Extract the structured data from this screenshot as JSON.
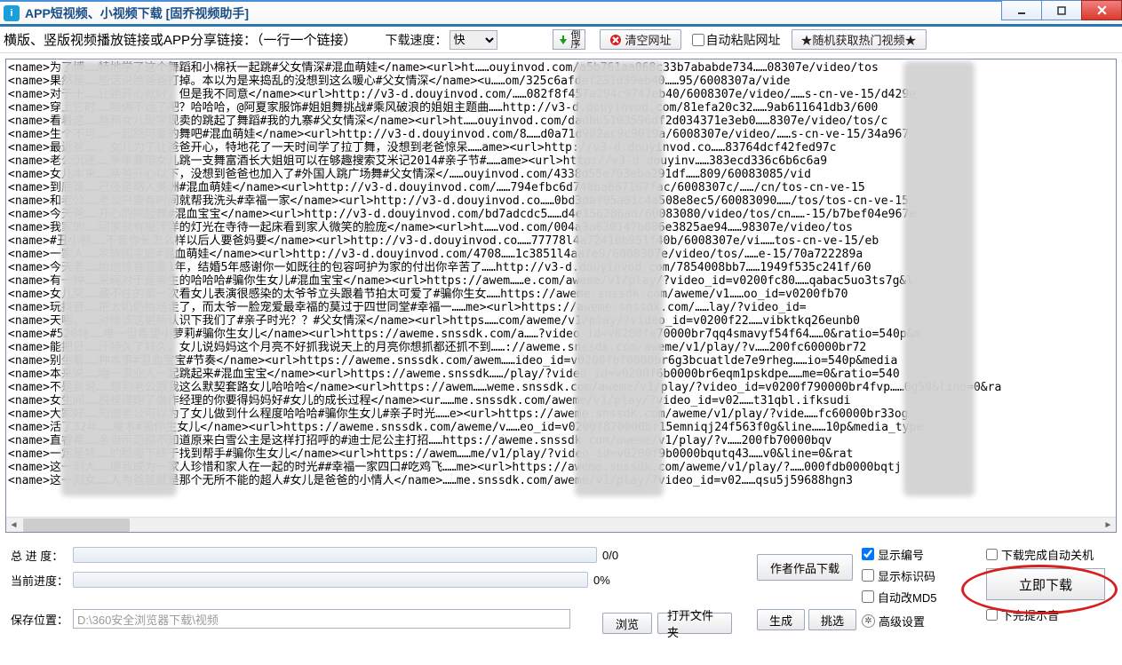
{
  "window": {
    "title": "APP短视频、小视频下载 [固乔视频助手]",
    "app_icon_letter": "i"
  },
  "toolbar": {
    "instruction": "横版、竖版视频播放链接或APP分享链接：（一行一个链接）",
    "speed_label": "下载速度：",
    "speed_value": "快",
    "sort_btn_top": "倒",
    "sort_btn_bottom": "序",
    "clear_btn": "清空网址",
    "autopaste_label": "自动粘贴网址",
    "hot_btn": "★随机获取热门视频★"
  },
  "textarea_lines": [
    "<name>为了博……特地学了这个舞蹈和小棉袄一起跳#父女情深#混血萌娃</name><url>ht……ouyinvod.com/a5b761aa068c33b7ababde734……08307e/video/tos",
    "<name>果然是……些话说给爸爸打掉。本以为是来捣乱的没想到这么暖心#父女情深</name><u……om/325c6afdef231d39eb40……95/6008307a/vide",
    "<name>对于十……让她开心就好，但是我不同意</name><url>http://v3-d.douyinvod.com/……082f8f457a294c9747eb40/6008307e/video/……s-cn-ve-15/d429e",
    "<name>穿上它时……咱俩不远了吧？哈哈哈，@阿夏家服饰#姐姐舞挑战#乘风破浪的姐姐主题曲……http://v3-d.douyinvod.com/81efa20c32……9ab611641db3/600",
    "<name>看着这……爸和女儿现学现卖的跳起了舞蹈#我的九寨#父女情深</name><url>ht……ouyinvod.com/dadbb5103596df2d034371e3eb0……8307e/video/tos/c",
    "<name>生个不可……一起跳可爱的舞吧#混血萌娃</name><url>http://v3-d.douyinvod.com/8……d0a71d982ac9c9019a/6008307e/video/……s-cn-ve-15/34a967",
    "<name>最近爸……，女儿为了让爸爸开心，特地花了一天时间学了拉丁舞，没想到老爸惊呆……ame><url>http://v3-d.douyinvod.co……83764dcf42fed97c",
    "<name>老公沉迷……亲季要陪女儿跳一支舞富酒长大姐姐可以在够趣搜索艾米记2014#亲子节#……ame><url>http://v3-d.douyinv……383ecd336c6b6c6a9",
    "<name>女儿本来……亲爸开心以下，没想到爸爸也加入了#外国人跳广场舞#父女情深</……ouyinvod.com/4338d55e793eba291df……809/60083085/vid",
    "<name>到底谁……己还是略入美洲#混血萌娃</name><url>http://v3-d.douyinvod.com/……794efbc6d740ba867167fac/6008307c/……/cn/tos-cn-ve-15",
    "<name>和老公……老公只要有时间就帮我洗头#幸福一家</name><url>http://v3-d.douyinvod.co……0bd3daf95a01c4a508e8ec5/60083090……/tos/tos-cn-ve-15",
    "<name>今天爸……开心的跳起舞#混血宝宝</name><url>http://v3-d.douyinvod.com/bd7adcdc5……d4e156286ad/60083080/video/tos/cn……-15/b7bef04e967e",
    "<name>我家的……回家就有暖洋洋的灯光在寺待一起床看到家人微笑的脸庞</name><url>ht……vod.com/004a3a630147b086e3825ae94……98307e/video/tos",
    "<name>#丑小鸭……不管你长怎么样以后人要爸妈要</name><url>http://v3-d.douyinvod.co……77778l4a72410b951f40b/6008307e/vi……tos-cn-ve-15/eb",
    "<name>一家人……家族国家庭#混血萌娃</name><url>http://v3-d.douyinvod.com/4708……1c3851l4aafe9/6008307e/video/tos/……e-15/70a722289a",
    "<name>今天老……给他惊喜恋爱1年，结婚5年感谢你一如既往的包容呵护为家的付出你辛苦了……http://v3-d.douyinvod.com/7854008bb7……1949f535c241f/60",
    "<name>有一种……采碗对于是亲生的哈哈哈#骗你生女儿#混血宝宝</name><url>https://awem……e.com/aweme/v1/play/?video_id=v0200fc80……qabac5uo3ts7g&l",
    "<name>女儿突……藏不住的第一次看女儿表演很感染的太爷爷立头跟着节拍太可爱了#骗你生女……https://aweme.snssdk.com/aweme/v1……oo_id=v0200fb70",
    "<name>玩抖音……把太奶奶给送走了，而太爷一脸宠爱最幸福的莫过于四世同堂#幸福一……me><url>https://aweme.snssdk.com/……lay/?video_id=",
    "<name>天哪，……对候该这更新认识下我们了#亲子时光？？#父女情深</name><url>https……com/aweme/v1/play/?video_id=v0200f22……vibktkq26eunb0",
    "<name>#520特……唯一但希望小萝莉#骗你生女儿</name><url>https://aweme.snssdk.com/a……?video_id=v0200fe70000br7qq4smavyf54f64……0&ratio=540p&m",
    "<name>能把日……汁特久了好久，女儿说妈妈这个月亮不好抓我说天上的月亮你想抓都还抓不到……://aweme.snssdk.com/aweme/v1/play/?v……200fc60000br72",
    "<name>别坐看……种本事#混血宝宝#节奏</name><url>https://aweme.snssdk.com/awem……ideo_id=v0200fbf0000br6g3bcuatlde7e9rheg……io=540p&media",
    "<name>本来说……哦一家业人一起跳起来#混血宝宝</name><url>https://aweme.snssdk……/play/?video_id=v0200f6b0000br6eqm1pskdpe……me=0&ratio=540",
    "<name>不是我说……想到老公跟我这么默契套路女儿哈哈哈</name><url>https://awem……weme.snssdk.com/aweme/v1/play/?video_id=v0200f790000br4fvp……0g50&line=0&ra",
    "<name>女生间……脱膜理跑了做作经理的你要得妈妈好#女儿的成长过程</name><ur……me.snssdk.com/aweme/v1/play/?video_id=v02……t31qbl.ifksudi",
    "<name>大家好……知道老公可以为了女儿做到什么程度哈哈哈#骗你生女儿#亲子时光……e><url>https://aweme.snssdk.com/aweme/v1/play/?vide……fc60000br33og",
    "<name>活了32年……魔术#骗你生女儿</name><url>https://aweme.snssdk.com/aweme/v……eo_id=v0200f870000br15emniqj24f563f0g&line……10p&media_type",
    "<name>直睿希……亲自示范都不知道原来白雪公主是这样打招呼的#迪士尼公主打招……https://aweme.snssdk.com/aweme/v1/play/?v……200fb70000bqv",
    "<name>一定是特……的脸蛋下终于找到帮手#骗你生女儿</name><url>https://awem……me/v1/play/?video_id=v0200f9b0000bqutq43……v0&line=0&rat",
    "<name>这一刻大……便我成为一家人珍惜和家人在一起的时光##幸福一家四口#吃鸡飞……me><url>https://aweme.snssdk.com/aweme/v1/play/?……000fdb0000bqtj",
    "<name>这一刻女……人为爸爸就是那个无所不能的超人#女儿是爸爸的小情人</name>……me.snssdk.com/aweme/v1/play/?video_id=v02……qsu5j59688hgn3"
  ],
  "progress": {
    "total_label": "总 进 度：",
    "total_text": "0/0",
    "current_label": "当前进度：",
    "current_text": "0%"
  },
  "save": {
    "label": "保存位置：",
    "path": "D:\\360安全浏览器下载\\视频"
  },
  "buttons": {
    "browse": "浏览",
    "open_folder": "打开文件夹",
    "author_works": "作者作品下载",
    "generate": "生成",
    "filter": "挑选",
    "download_now": "立即下载"
  },
  "options": {
    "show_index": "显示编号",
    "show_bitrate": "显示标识码",
    "auto_md5": "自动改MD5",
    "advanced": "高级设置",
    "auto_shutdown": "下载完成自动关机",
    "finish_sound": "下完提示音"
  }
}
